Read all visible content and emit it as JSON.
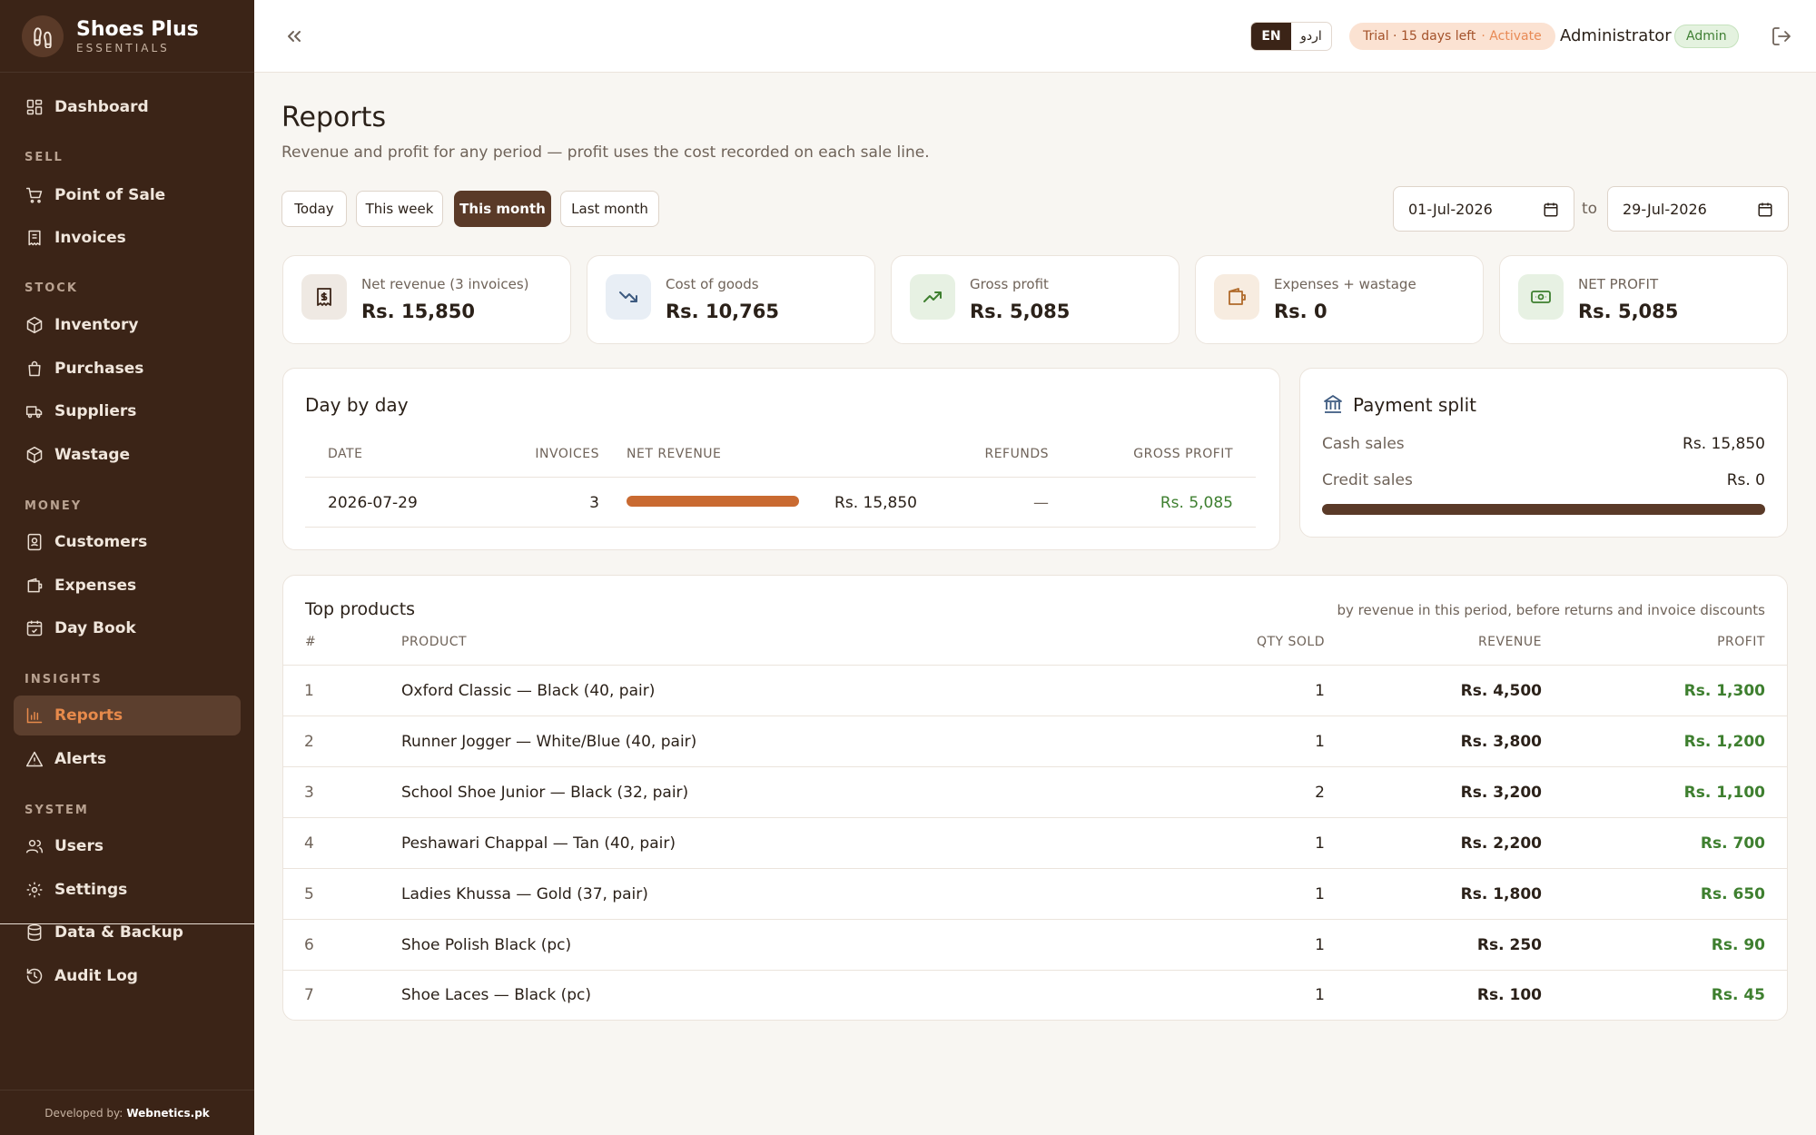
{
  "brand": {
    "name": "Shoes Plus",
    "sub": "ESSENTIALS"
  },
  "nav": {
    "dashboard": "Dashboard",
    "sec_sell": "SELL",
    "pos": "Point of Sale",
    "invoices": "Invoices",
    "sec_stock": "STOCK",
    "inventory": "Inventory",
    "purchases": "Purchases",
    "suppliers": "Suppliers",
    "wastage": "Wastage",
    "sec_money": "MONEY",
    "customers": "Customers",
    "expenses": "Expenses",
    "daybook": "Day Book",
    "sec_insights": "INSIGHTS",
    "reports": "Reports",
    "alerts": "Alerts",
    "sec_system": "SYSTEM",
    "users": "Users",
    "settings": "Settings",
    "backup": "Data & Backup",
    "audit": "Audit Log"
  },
  "footer": {
    "label": "Developed by:",
    "company": "Webnetics.pk"
  },
  "topbar": {
    "lang_en": "EN",
    "lang_ur": "اردو",
    "trial": "Trial · 15 days left",
    "trial_action": "· Activate",
    "user": "Administrator",
    "role": "Admin"
  },
  "page": {
    "title": "Reports",
    "subtitle": "Revenue and profit for any period — profit uses the cost recorded on each sale line."
  },
  "periods": {
    "today": "Today",
    "week": "This week",
    "month": "This month",
    "last": "Last month",
    "selected": "This month"
  },
  "range": {
    "from": "01-Jul-2026",
    "to_label": "to",
    "to": "29-Jul-2026"
  },
  "kpis": [
    {
      "label": "Net revenue (3 invoices)",
      "value": "Rs. 15,850",
      "icon": "receipt-icon"
    },
    {
      "label": "Cost of goods",
      "value": "Rs. 10,765",
      "icon": "trend-down-icon"
    },
    {
      "label": "Gross profit",
      "value": "Rs. 5,085",
      "icon": "trend-up-icon"
    },
    {
      "label": "Expenses + wastage",
      "value": "Rs. 0",
      "icon": "wallet-icon"
    },
    {
      "label": "NET PROFIT",
      "value": "Rs. 5,085",
      "icon": "cash-icon"
    }
  ],
  "daybyday": {
    "title": "Day by day",
    "headers": {
      "date": "DATE",
      "invoices": "INVOICES",
      "net_revenue": "NET REVENUE",
      "refunds": "REFUNDS",
      "gross_profit": "GROSS PROFIT"
    },
    "rows": [
      {
        "date": "2026-07-29",
        "invoices": "3",
        "revenue": "Rs. 15,850",
        "revenue_share": 1.0,
        "refunds": "—",
        "profit": "Rs. 5,085"
      }
    ]
  },
  "payment": {
    "title": "Payment split",
    "cash_label": "Cash sales",
    "cash": "Rs. 15,850",
    "credit_label": "Credit sales",
    "credit": "Rs. 0",
    "cash_share": 1.0
  },
  "top": {
    "title": "Top products",
    "note": "by revenue in this period, before returns and invoice discounts",
    "headers": {
      "num": "#",
      "product": "PRODUCT",
      "qty": "QTY SOLD",
      "revenue": "REVENUE",
      "profit": "PROFIT"
    },
    "rows": [
      {
        "n": "1",
        "product": "Oxford Classic — Black (40, pair)",
        "qty": "1",
        "revenue": "Rs. 4,500",
        "profit": "Rs. 1,300"
      },
      {
        "n": "2",
        "product": "Runner Jogger — White/Blue (40, pair)",
        "qty": "1",
        "revenue": "Rs. 3,800",
        "profit": "Rs. 1,200"
      },
      {
        "n": "3",
        "product": "School Shoe Junior — Black (32, pair)",
        "qty": "2",
        "revenue": "Rs. 3,200",
        "profit": "Rs. 1,100"
      },
      {
        "n": "4",
        "product": "Peshawari Chappal — Tan (40, pair)",
        "qty": "1",
        "revenue": "Rs. 2,200",
        "profit": "Rs. 700"
      },
      {
        "n": "5",
        "product": "Ladies Khussa — Gold (37, pair)",
        "qty": "1",
        "revenue": "Rs. 1,800",
        "profit": "Rs. 650"
      },
      {
        "n": "6",
        "product": "Shoe Polish Black (pc)",
        "qty": "1",
        "revenue": "Rs. 250",
        "profit": "Rs. 90"
      },
      {
        "n": "7",
        "product": "Shoe Laces — Black (pc)",
        "qty": "1",
        "revenue": "Rs. 100",
        "profit": "Rs. 45"
      }
    ]
  },
  "colors": {
    "sidebar": "#3b2417",
    "accent": "#c96a31",
    "active_text": "#e78a4b",
    "profit": "#3e7f2f"
  }
}
